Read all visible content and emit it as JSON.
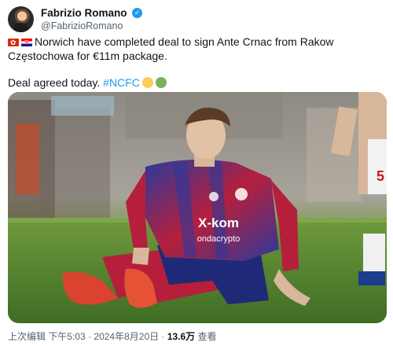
{
  "author": {
    "display_name": "Fabrizio Romano",
    "handle": "@FabrizioRomano",
    "verified": true
  },
  "tweet": {
    "flags": [
      "hong-kong-flag-icon",
      "croatia-flag-icon"
    ],
    "line1": "Norwich have completed deal to sign Ante Crnac from Rakow",
    "line2": "Częstochowa for €11m package.",
    "line3": "Deal agreed today.",
    "hashtag": "#NCFC",
    "emojis": [
      {
        "name": "yellow-circle-icon",
        "color": "#fdcb58"
      },
      {
        "name": "green-circle-icon",
        "color": "#78b159"
      }
    ]
  },
  "photo": {
    "jersey_sponsor": "X-kom",
    "jersey_sponsor_sub": "ondacrypto",
    "number": "5"
  },
  "meta": {
    "edited": "上次编辑",
    "time": "下午5:03",
    "date": "2024年8月20日",
    "views": "13.6万",
    "views_label": "查看",
    "sep": "·"
  }
}
